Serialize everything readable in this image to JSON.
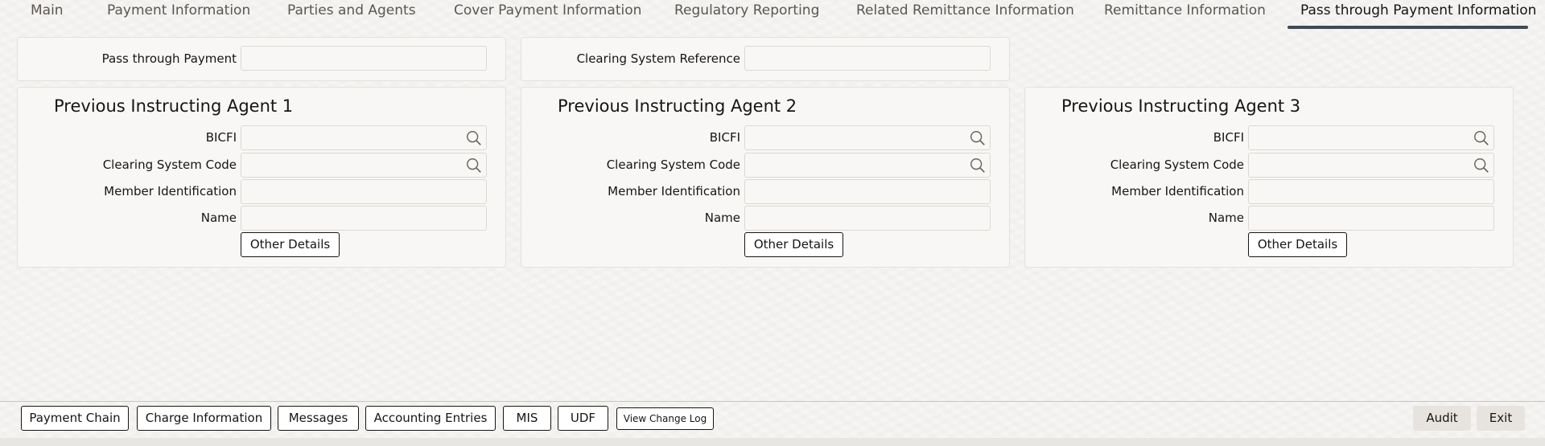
{
  "tabs": [
    {
      "label": "Main"
    },
    {
      "label": "Payment Information"
    },
    {
      "label": "Parties and Agents"
    },
    {
      "label": "Cover Payment Information"
    },
    {
      "label": "Regulatory Reporting"
    },
    {
      "label": "Related Remittance Information"
    },
    {
      "label": "Remittance Information"
    },
    {
      "label": "Pass through Payment Information"
    }
  ],
  "active_tab": "Pass through Payment Information",
  "top": {
    "pass_through_payment": {
      "label": "Pass through Payment",
      "value": ""
    },
    "clearing_system_reference": {
      "label": "Clearing System Reference",
      "value": ""
    }
  },
  "agents": [
    {
      "title": "Previous Instructing Agent 1",
      "bicfi_label": "BICFI",
      "bicfi_value": "",
      "csc_label": "Clearing System Code",
      "csc_value": "",
      "member_label": "Member Identification",
      "member_value": "",
      "name_label": "Name",
      "name_value": "",
      "details_button": "Other Details"
    },
    {
      "title": "Previous Instructing Agent 2",
      "bicfi_label": "BICFI",
      "bicfi_value": "",
      "csc_label": "Clearing System Code",
      "csc_value": "",
      "member_label": "Member Identification",
      "member_value": "",
      "name_label": "Name",
      "name_value": "",
      "details_button": "Other Details"
    },
    {
      "title": "Previous Instructing Agent 3",
      "bicfi_label": "BICFI",
      "bicfi_value": "",
      "csc_label": "Clearing System Code",
      "csc_value": "",
      "member_label": "Member Identification",
      "member_value": "",
      "name_label": "Name",
      "name_value": "",
      "details_button": "Other Details"
    }
  ],
  "footer": {
    "buttons": [
      {
        "label": "Payment Chain"
      },
      {
        "label": "Charge Information"
      },
      {
        "label": "Messages"
      },
      {
        "label": "Accounting Entries"
      },
      {
        "label": "MIS"
      },
      {
        "label": "UDF"
      },
      {
        "label": "View Change Log"
      }
    ],
    "audit": "Audit",
    "exit": "Exit"
  },
  "icons": {
    "lookup": "search-icon"
  }
}
